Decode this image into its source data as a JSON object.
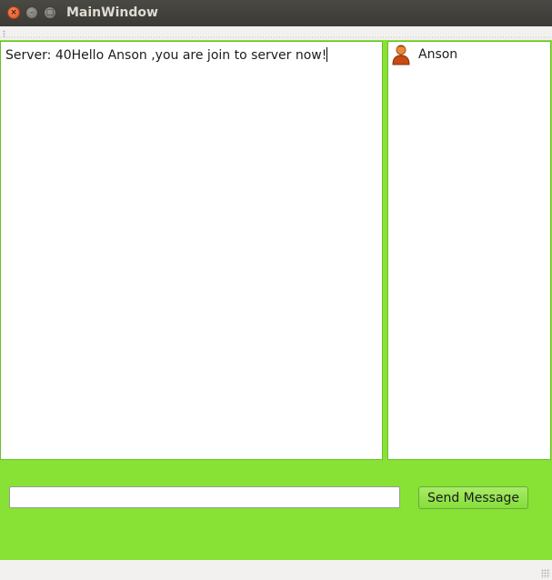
{
  "window": {
    "title": "MainWindow",
    "close_glyph": "×",
    "minimize_glyph": "–",
    "maximize_glyph": "□"
  },
  "chat": {
    "lines": [
      "Server:  40Hello Anson ,you are join to server now!"
    ]
  },
  "users": {
    "items": [
      {
        "name": "Anson",
        "icon": "user-avatar-icon"
      }
    ]
  },
  "message_input": {
    "value": "",
    "placeholder": ""
  },
  "send_button": {
    "label": "Send Message"
  },
  "colors": {
    "accent_green": "#87e235",
    "titlebar": "#3b3a36",
    "close_button": "#e2501e"
  }
}
